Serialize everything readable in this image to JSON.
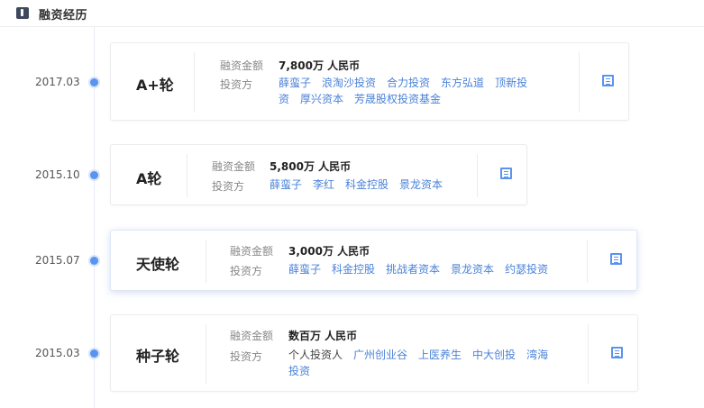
{
  "header": {
    "title": "融资经历",
    "icon": "money-bag-icon"
  },
  "labels": {
    "amount": "融资金额",
    "investors": "投资方"
  },
  "colors": {
    "accent": "#5b93f0",
    "link": "#4a82d8"
  },
  "rounds": [
    {
      "date": "2017.03",
      "round": "A+轮",
      "amount": "7,800万 人民币",
      "investors_line1": [
        "薛蛮子",
        "浪淘沙投资",
        "合力投资",
        "东方弘道",
        "顶新投"
      ],
      "investors_line2": [
        "资",
        "厚兴资本",
        "芳晟股权投资基金"
      ]
    },
    {
      "date": "2015.10",
      "round": "A轮",
      "amount": "5,800万 人民币",
      "investors_line1": [
        "薛蛮子",
        "李红",
        "科金控股",
        "景龙资本"
      ],
      "investors_line2": []
    },
    {
      "date": "2015.07",
      "round": "天使轮",
      "amount": "3,000万 人民币",
      "investors_line1": [
        "薛蛮子",
        "科金控股",
        "挑战者资本",
        "景龙资本",
        "约瑟投资"
      ],
      "investors_line2": []
    },
    {
      "date": "2015.03",
      "round": "种子轮",
      "amount": "数百万 人民币",
      "investors_line1": [
        "个人投资人",
        "广州创业谷",
        "上医养生",
        "中大创投",
        "湾海"
      ],
      "investors_line2": [
        "投资"
      ]
    }
  ]
}
